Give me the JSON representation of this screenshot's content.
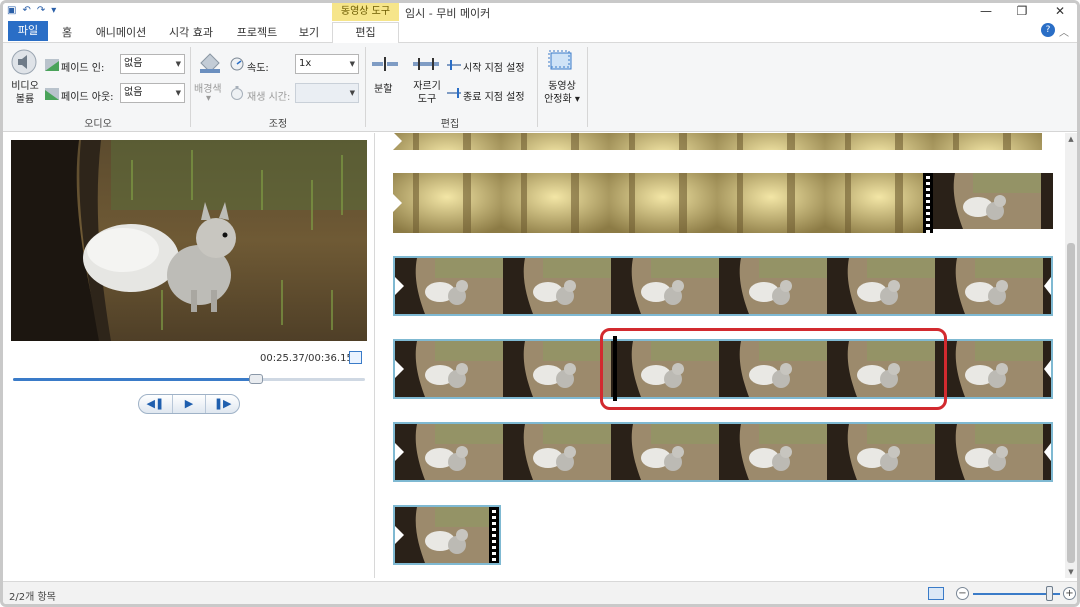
{
  "window": {
    "title": "임시 - 무비 메이커",
    "context_tab": "동영상 도구",
    "minimize": "—",
    "maximize": "❐",
    "close": "✕"
  },
  "tabs": [
    {
      "label": "파일"
    },
    {
      "label": "홈"
    },
    {
      "label": "애니메이션"
    },
    {
      "label": "시각 효과"
    },
    {
      "label": "프로젝트"
    },
    {
      "label": "보기"
    },
    {
      "label": "편집"
    }
  ],
  "ribbon": {
    "audio": {
      "video_volume": "비디오\n볼륨",
      "video_volume_line1": "비디오",
      "video_volume_line2": "볼륨",
      "fade_in_label": "페이드 인:",
      "fade_in_value": "없음",
      "fade_out_label": "페이드 아웃:",
      "fade_out_value": "없음",
      "group_label": "오디오"
    },
    "adjust": {
      "background_color": "배경색",
      "speed_label": "속도:",
      "speed_value": "1x",
      "duration_label": "재생 시간:",
      "duration_value": "",
      "group_label": "조정"
    },
    "edit": {
      "split": "분할",
      "trim_tool_line1": "자르기",
      "trim_tool_line2": "도구",
      "set_start_point": "시작 지점 설정",
      "set_end_point": "종료 지점 설정",
      "group_label": "편집"
    },
    "stabilize": {
      "line1": "동영상",
      "line2": "안정화"
    }
  },
  "preview": {
    "timecode": "00:25.37/00:36.15",
    "seek_progress": 0.69
  },
  "statusbar": {
    "items_text": "2/2개 항목",
    "zoom_level": 0.88
  },
  "colors": {
    "accent_blue": "#2a6ec6",
    "selection_border": "#7fb9d2",
    "annotation_red": "#d22a2f",
    "context_tab": "#f6e58a"
  }
}
